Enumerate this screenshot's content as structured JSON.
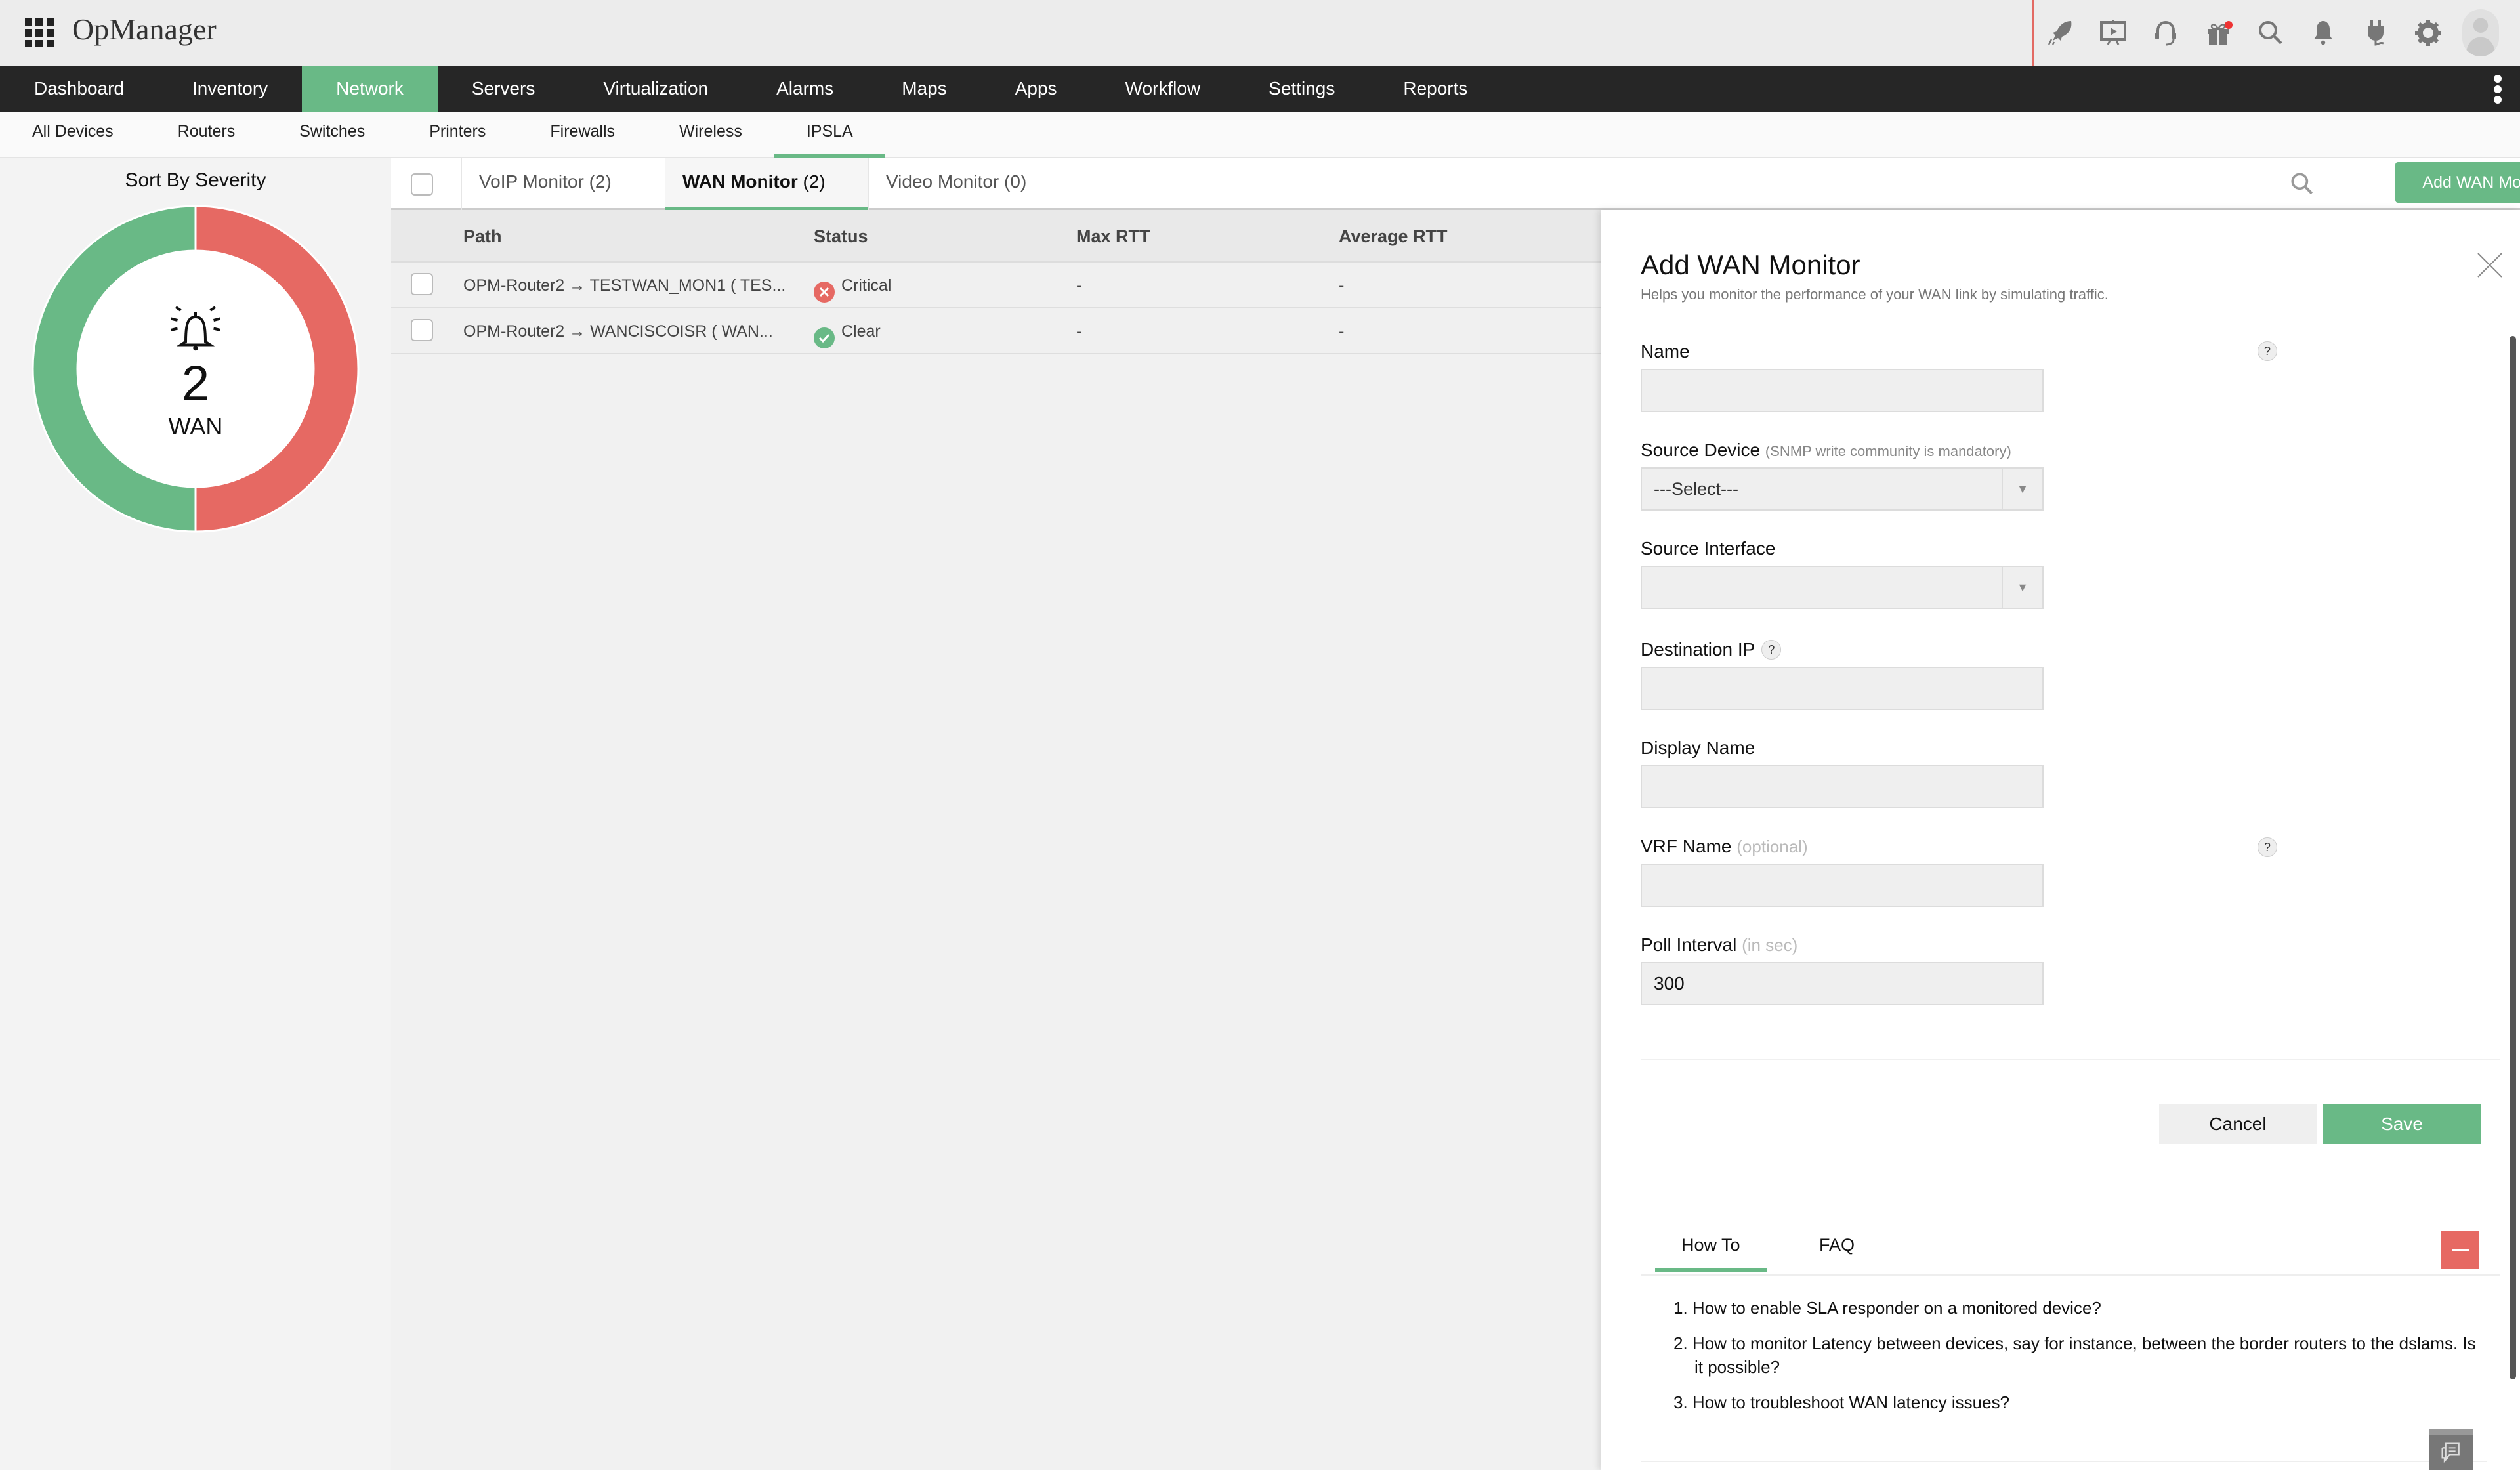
{
  "app": {
    "title": "OpManager",
    "top_icons": [
      "rocket-icon",
      "presentation-icon",
      "headset-icon",
      "gift-icon",
      "search-icon",
      "bell-icon",
      "plug-icon",
      "gear-icon",
      "user-avatar"
    ],
    "colors": {
      "accent": "#69b986",
      "critical": "#e66963",
      "nav_bg": "#262626"
    }
  },
  "main_nav": {
    "items": [
      "Dashboard",
      "Inventory",
      "Network",
      "Servers",
      "Virtualization",
      "Alarms",
      "Maps",
      "Apps",
      "Workflow",
      "Settings",
      "Reports"
    ],
    "active": "Network"
  },
  "sub_nav": {
    "items": [
      "All Devices",
      "Routers",
      "Switches",
      "Printers",
      "Firewalls",
      "Wireless",
      "IPSLA"
    ],
    "active": "IPSLA"
  },
  "severity_panel": {
    "title": "Sort By Severity",
    "count": "2",
    "label": "WAN",
    "segments": [
      {
        "name": "Critical",
        "value": 1,
        "color": "#e66963"
      },
      {
        "name": "Clear",
        "value": 1,
        "color": "#69b986"
      }
    ]
  },
  "monitor_tabs": [
    {
      "name": "VoIP Monitor",
      "count": "(2)"
    },
    {
      "name": "WAN Monitor",
      "count": "(2)"
    },
    {
      "name": "Video Monitor",
      "count": "(0)"
    }
  ],
  "toolbar": {
    "add_button": "Add WAN Monitor"
  },
  "table": {
    "columns": [
      "Path",
      "Status",
      "Max RTT",
      "Average RTT"
    ],
    "rows": [
      {
        "path": "OPM-Router2 → TESTWAN_MON1 ( TES...",
        "status": "Critical",
        "max_rtt": "-",
        "avg_rtt": "-"
      },
      {
        "path": "OPM-Router2 → WANCISCOISR ( WAN...",
        "status": "Clear",
        "max_rtt": "-",
        "avg_rtt": "-"
      }
    ]
  },
  "panel": {
    "title": "Add WAN Monitor",
    "subtitle": "Helps you monitor the performance of your WAN link by simulating traffic.",
    "fields": {
      "name": {
        "label": "Name",
        "value": ""
      },
      "source_device": {
        "label": "Source Device",
        "hint": "(SNMP write community is mandatory)",
        "value": "---Select---"
      },
      "source_interface": {
        "label": "Source Interface",
        "value": ""
      },
      "destination_ip": {
        "label": "Destination IP",
        "value": ""
      },
      "display_name": {
        "label": "Display Name",
        "value": ""
      },
      "vrf_name": {
        "label": "VRF Name",
        "hint": "(optional)",
        "value": ""
      },
      "poll_interval": {
        "label": "Poll Interval",
        "hint": "(in sec)",
        "value": "300"
      }
    },
    "help_marker": "?",
    "cancel": "Cancel",
    "save": "Save",
    "help_tabs": [
      "How To",
      "FAQ"
    ],
    "active_help_tab": "How To",
    "howto": [
      "1. How to enable SLA responder on a monitored device?",
      "2. How to monitor Latency between devices, say for instance, between the border routers to the dslams. Is it possible?",
      "3. How to troubleshoot WAN latency issues?"
    ]
  }
}
